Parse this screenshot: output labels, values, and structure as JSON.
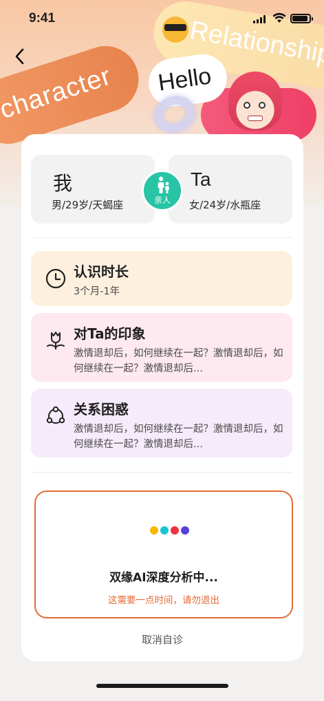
{
  "status_bar": {
    "time": "9:41"
  },
  "hero": {
    "word_character": "character",
    "word_relationship": "Relationship",
    "word_hello": "Hello"
  },
  "me": {
    "name": "我",
    "info": "男/29岁/天蝎座"
  },
  "ta": {
    "name": "Ta",
    "info": "女/24岁/水瓶座"
  },
  "relation": {
    "label": "亲人",
    "color": "#27c4a6"
  },
  "duration": {
    "title": "认识时长",
    "value": "3个月-1年",
    "bg": "#fdf0de"
  },
  "impression": {
    "title": "对Ta的印象",
    "text": "激情退却后，如何继续在一起？激情退却后，如何继续在一起？激情退却后...",
    "bg": "#fde9ef"
  },
  "confusion": {
    "title": "关系困惑",
    "text": "激情退却后，如何继续在一起？激情退却后，如何继续在一起？激情退却后...",
    "bg": "#f6ebfa"
  },
  "analysis": {
    "message": "双缘AI深度分析中...",
    "note": "这需要一点时间，请勿退出",
    "accent": "#e46a36",
    "dot_colors": [
      "#f5b800",
      "#16c6cf",
      "#ef3340",
      "#5a3fd6"
    ]
  },
  "cancel_label": "取消自诊"
}
